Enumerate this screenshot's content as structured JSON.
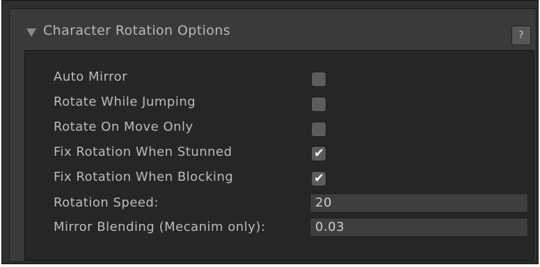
{
  "panel": {
    "title": "Character Rotation Options",
    "help_label": "?"
  },
  "options": [
    {
      "label": "Auto Mirror",
      "checked": false
    },
    {
      "label": "Rotate While Jumping",
      "checked": false
    },
    {
      "label": "Rotate On Move Only",
      "checked": false
    },
    {
      "label": "Fix Rotation When Stunned",
      "checked": true
    },
    {
      "label": "Fix Rotation When Blocking",
      "checked": true
    }
  ],
  "fields": [
    {
      "label": "Rotation Speed:",
      "value": "20"
    },
    {
      "label": "Mirror Blending (Mecanim only):",
      "value": "0.03"
    }
  ],
  "checkmark_glyph": "✔"
}
